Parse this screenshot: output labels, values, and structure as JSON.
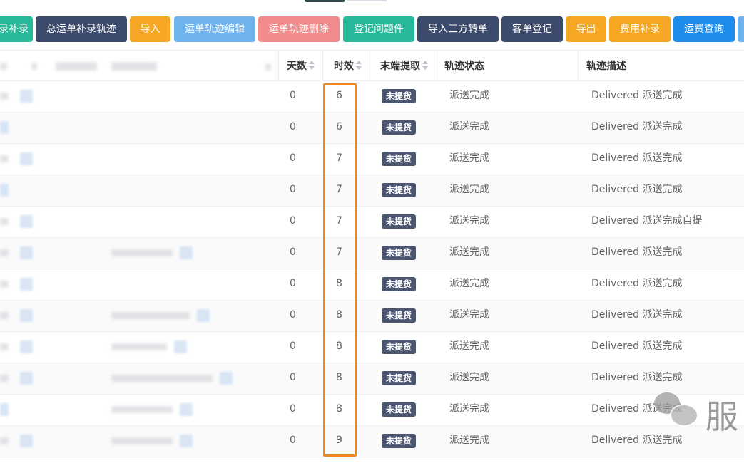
{
  "toolbar": {
    "buttons": [
      {
        "label": "录补录",
        "color": "#26b99a"
      },
      {
        "label": "总运单补录轨迹",
        "color": "#3c4a6b"
      },
      {
        "label": "导入",
        "color": "#f5a623"
      },
      {
        "label": "运单轨迹编辑",
        "color": "#6fb3ef"
      },
      {
        "label": "运单轨迹删除",
        "color": "#f28b8b"
      },
      {
        "label": "登记问题件",
        "color": "#26b99a"
      },
      {
        "label": "导入三方转单",
        "color": "#3c4a6b"
      },
      {
        "label": "客单登记",
        "color": "#3c4a6b"
      },
      {
        "label": "导出",
        "color": "#f5a623"
      },
      {
        "label": "费用补录",
        "color": "#f5a623"
      },
      {
        "label": "运费查询",
        "color": "#1f8ceb"
      }
    ]
  },
  "table": {
    "headers": {
      "days": "天数",
      "aging": "时效",
      "last_mile": "末端提取",
      "track_status": "轨迹状态",
      "track_desc": "轨迹描述"
    },
    "rows": [
      {
        "days": "0",
        "aging": "6",
        "tag": "未提货",
        "status": "派送完成",
        "desc": "Delivered 派送完成"
      },
      {
        "days": "0",
        "aging": "6",
        "tag": "未提货",
        "status": "派送完成",
        "desc": "Delivered 派送完成"
      },
      {
        "days": "0",
        "aging": "7",
        "tag": "未提货",
        "status": "派送完成",
        "desc": "Delivered 派送完成"
      },
      {
        "days": "0",
        "aging": "7",
        "tag": "未提货",
        "status": "派送完成",
        "desc": "Delivered 派送完成"
      },
      {
        "days": "0",
        "aging": "7",
        "tag": "未提货",
        "status": "派送完成",
        "desc": "Delivered 派送完成自提"
      },
      {
        "days": "0",
        "aging": "7",
        "tag": "未提货",
        "status": "派送完成",
        "desc": "Delivered 派送完成"
      },
      {
        "days": "0",
        "aging": "8",
        "tag": "未提货",
        "status": "派送完成",
        "desc": "Delivered 派送完成"
      },
      {
        "days": "0",
        "aging": "8",
        "tag": "未提货",
        "status": "派送完成",
        "desc": "Delivered 派送完成"
      },
      {
        "days": "0",
        "aging": "8",
        "tag": "未提货",
        "status": "派送完成",
        "desc": "Delivered 派送完成"
      },
      {
        "days": "0",
        "aging": "8",
        "tag": "未提货",
        "status": "派送完成",
        "desc": "Delivered 派送完成"
      },
      {
        "days": "0",
        "aging": "8",
        "tag": "未提货",
        "status": "派送完成",
        "desc": "Delivered 派送完成"
      },
      {
        "days": "0",
        "aging": "9",
        "tag": "未提货",
        "status": "派送完成",
        "desc": "Delivered 派送完成"
      }
    ]
  },
  "watermark": {
    "text": "服"
  },
  "colors": {
    "highlight": "#f0871d",
    "tag_bg": "#4b5570"
  }
}
